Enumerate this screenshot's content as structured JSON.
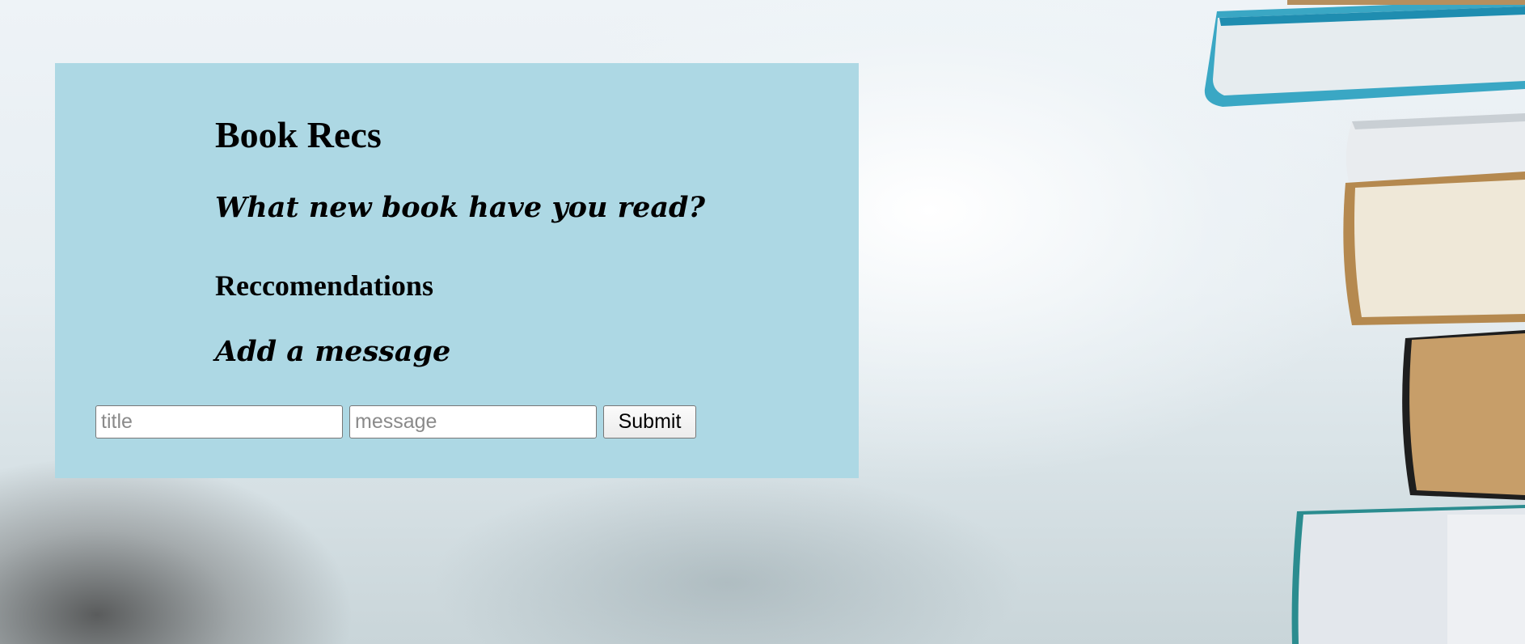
{
  "card": {
    "title": "Book Recs",
    "prompt": "What new book have you read?",
    "recommendations_heading": "Reccomendations",
    "add_message_heading": "Add a message"
  },
  "form": {
    "title_placeholder": "title",
    "message_placeholder": "message",
    "submit_label": "Submit"
  },
  "colors": {
    "card_background": "#add8e4"
  }
}
